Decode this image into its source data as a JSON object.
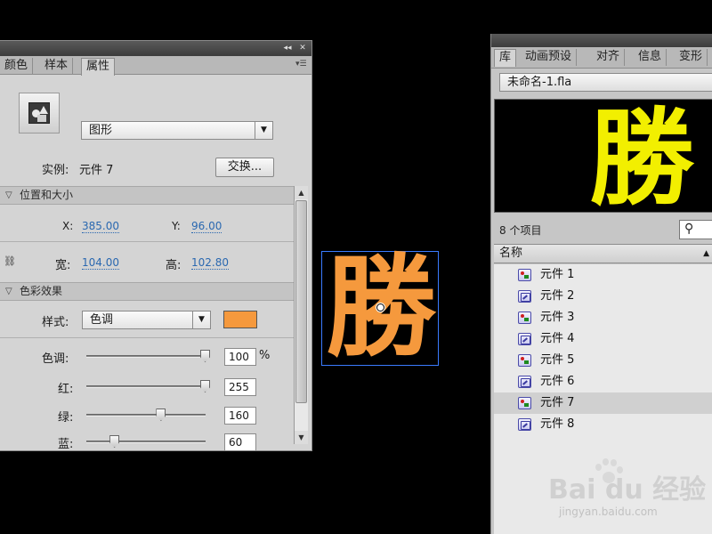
{
  "props_panel": {
    "tabs": [
      {
        "label": "颜色",
        "active": false
      },
      {
        "label": "样本",
        "active": false
      },
      {
        "label": "属性",
        "active": true
      }
    ],
    "symbol_type": "图形",
    "instance_label": "实例:",
    "instance_name": "元件 7",
    "swap_button": "交换...",
    "position_section": "位置和大小",
    "x_label": "X:",
    "x_value": "385.00",
    "y_label": "Y:",
    "y_value": "96.00",
    "w_label": "宽:",
    "w_value": "104.00",
    "h_label": "高:",
    "h_value": "102.80",
    "color_section": "色彩效果",
    "style_label": "样式:",
    "style_value": "色调",
    "tint_color": "#f5993d",
    "sliders": [
      {
        "label": "色调:",
        "value": "100",
        "unit": "%",
        "fraction": 1.0
      },
      {
        "label": "红:",
        "value": "255",
        "unit": "",
        "fraction": 1.0
      },
      {
        "label": "绿:",
        "value": "160",
        "unit": "",
        "fraction": 0.63
      },
      {
        "label": "蓝:",
        "value": "60",
        "unit": "",
        "fraction": 0.24
      }
    ]
  },
  "stage": {
    "char": "勝",
    "char_color": "#f5993d"
  },
  "library_panel": {
    "tabs": [
      {
        "label": "库",
        "active": true
      },
      {
        "label": "动画预设",
        "active": false
      },
      {
        "label": "对齐",
        "active": false
      },
      {
        "label": "信息",
        "active": false
      },
      {
        "label": "变形",
        "active": false
      }
    ],
    "document": "未命名-1.fla",
    "preview_char": "勝",
    "preview_color": "#f2ef00",
    "item_count": "8 个项目",
    "column_header": "名称",
    "items": [
      {
        "name": "元件 1",
        "icon": "graphic-symbol-icon"
      },
      {
        "name": "元件 2",
        "icon": "movieclip-symbol-icon"
      },
      {
        "name": "元件 3",
        "icon": "graphic-symbol-icon"
      },
      {
        "name": "元件 4",
        "icon": "movieclip-symbol-icon"
      },
      {
        "name": "元件 5",
        "icon": "graphic-symbol-icon"
      },
      {
        "name": "元件 6",
        "icon": "movieclip-symbol-icon"
      },
      {
        "name": "元件 7",
        "icon": "graphic-symbol-icon",
        "selected": true
      },
      {
        "name": "元件 8",
        "icon": "movieclip-symbol-icon"
      }
    ]
  },
  "watermark": {
    "brand": "Bai du 经验",
    "url": "jingyan.baidu.com"
  }
}
